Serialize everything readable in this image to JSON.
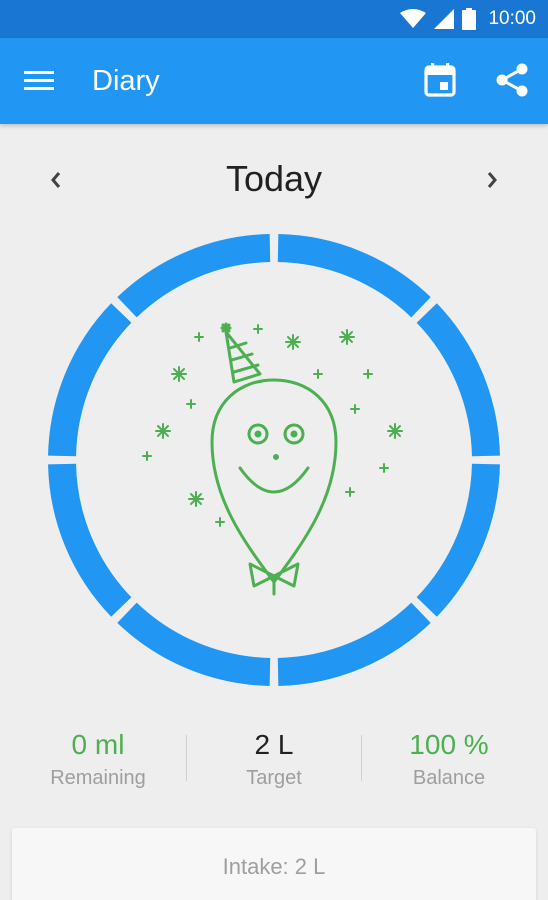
{
  "status_bar": {
    "time": "10:00",
    "icons": [
      "wifi-icon",
      "signal-icon",
      "battery-icon"
    ]
  },
  "app_bar": {
    "title": "Diary",
    "menu_icon": "menu-icon",
    "actions": [
      "calendar-icon",
      "share-icon"
    ]
  },
  "date_nav": {
    "label": "Today",
    "prev_icon": "chevron-left-icon",
    "next_icon": "chevron-right-icon"
  },
  "progress": {
    "fraction": 1.0,
    "segments": 8,
    "illustration": "party-balloon-illustration"
  },
  "stats": {
    "remaining": {
      "value": "0 ml",
      "label": "Remaining"
    },
    "target": {
      "value": "2 L",
      "label": "Target"
    },
    "balance": {
      "value": "100 %",
      "label": "Balance"
    }
  },
  "intake": {
    "text": "Intake: 2 L"
  },
  "colors": {
    "primary": "#2196f3",
    "primary_dark": "#1976d2",
    "accent_green": "#4caf50",
    "ring": "#2196f3",
    "text_dark": "#212121",
    "text_muted": "#9e9e9e"
  }
}
